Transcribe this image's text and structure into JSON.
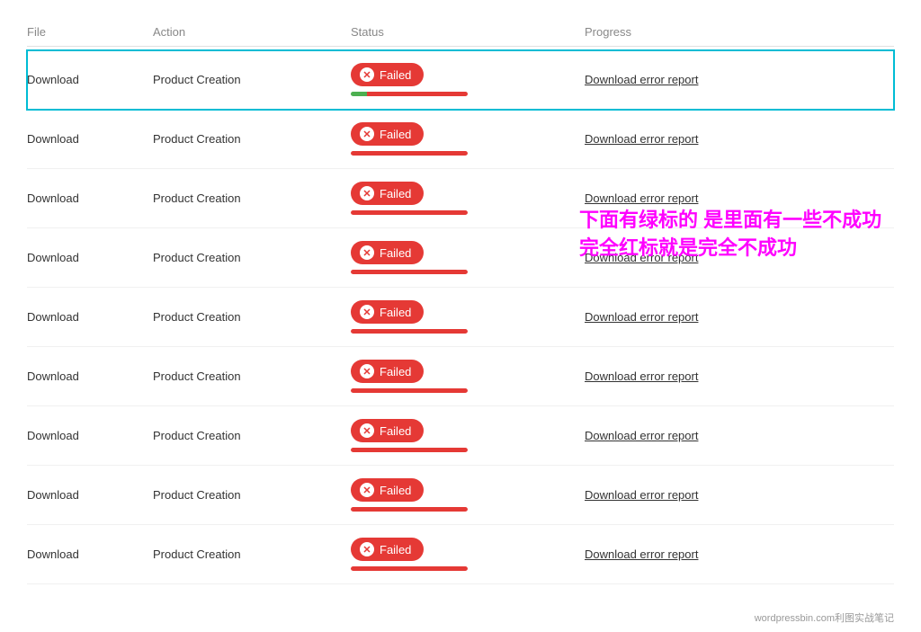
{
  "table": {
    "columns": [
      "File",
      "Action",
      "Status",
      "Progress"
    ],
    "failed_label": "Failed",
    "download_link_label": "Download error report",
    "rows": [
      {
        "file": "Download",
        "action": "Product Creation",
        "status": "Failed",
        "highlighted": true,
        "progress_type": "mixed"
      },
      {
        "file": "Download",
        "action": "Product Creation",
        "status": "Failed",
        "highlighted": false,
        "progress_type": "red"
      },
      {
        "file": "Download",
        "action": "Product Creation",
        "status": "Failed",
        "highlighted": false,
        "progress_type": "red"
      },
      {
        "file": "Download",
        "action": "Product Creation",
        "status": "Failed",
        "highlighted": false,
        "progress_type": "red"
      },
      {
        "file": "Download",
        "action": "Product Creation",
        "status": "Failed",
        "highlighted": false,
        "progress_type": "red"
      },
      {
        "file": "Download",
        "action": "Product Creation",
        "status": "Failed",
        "highlighted": false,
        "progress_type": "red"
      },
      {
        "file": "Download",
        "action": "Product Creation",
        "status": "Failed",
        "highlighted": false,
        "progress_type": "red"
      },
      {
        "file": "Download",
        "action": "Product Creation",
        "status": "Failed",
        "highlighted": false,
        "progress_type": "red"
      },
      {
        "file": "Download",
        "action": "Product Creation",
        "status": "Failed",
        "highlighted": false,
        "progress_type": "red"
      }
    ]
  },
  "annotation": {
    "text": "下面有绿标的 是里面有一些不成功 完全红标就是完全不成功"
  },
  "watermark": "wordpressbin.com利图实战笔记"
}
